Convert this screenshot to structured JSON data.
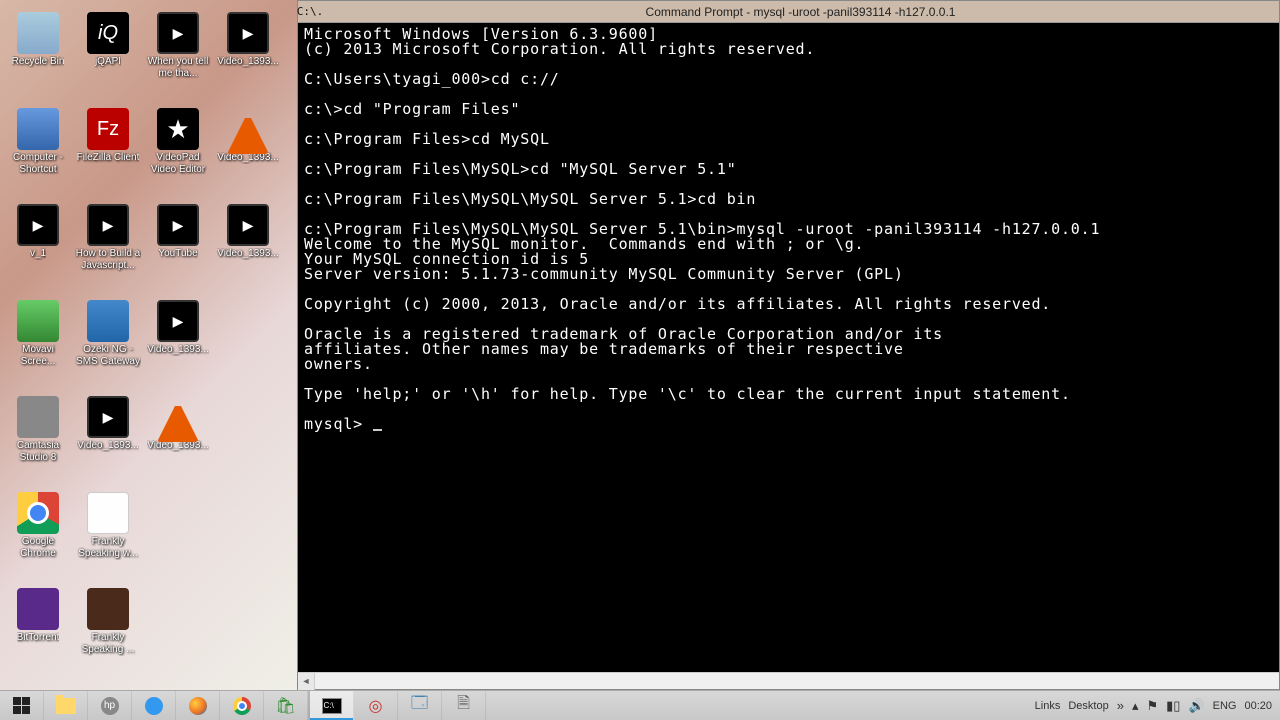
{
  "desktop_icons": [
    {
      "name": "recycle-bin",
      "label": "Recycle Bin",
      "style": "ic-bin"
    },
    {
      "name": "jqapi",
      "label": "jQAPI",
      "style": "ic-jq",
      "glyph": "iQ"
    },
    {
      "name": "when-you-tell",
      "label": "When you tell me tha...",
      "style": "ic-vid"
    },
    {
      "name": "video-1",
      "label": "Video_1393...",
      "style": "ic-vid"
    },
    {
      "name": "computer-shortcut",
      "label": "Computer - Shortcut",
      "style": "ic-monitor"
    },
    {
      "name": "filezilla",
      "label": "FileZilla Client",
      "style": "ic-fz",
      "glyph": "Fz"
    },
    {
      "name": "videopad",
      "label": "VideoPad Video Editor",
      "style": "ic-star"
    },
    {
      "name": "video-2",
      "label": "Video_1393...",
      "style": "ic-vlc"
    },
    {
      "name": "v1",
      "label": "v_1",
      "style": "ic-vid"
    },
    {
      "name": "howto-js",
      "label": "How to Build a Javascript...",
      "style": "ic-vid"
    },
    {
      "name": "youtube",
      "label": "YouTube",
      "style": "ic-vid"
    },
    {
      "name": "video-3",
      "label": "Video_1393...",
      "style": "ic-vid"
    },
    {
      "name": "movavi",
      "label": "Movavi Scree...",
      "style": "ic-movavi"
    },
    {
      "name": "ozeki",
      "label": "Ozeki NG - SMS Gateway",
      "style": "ic-ozeki"
    },
    {
      "name": "video-4",
      "label": "Video_1393...",
      "style": "ic-vid"
    },
    {
      "name": "blank-1",
      "label": "",
      "style": ""
    },
    {
      "name": "camtasia",
      "label": "Camtasia Studio 8",
      "style": "ic-camtasia"
    },
    {
      "name": "video-5",
      "label": "Video_1393...",
      "style": "ic-vid"
    },
    {
      "name": "video-6",
      "label": "Video_1393...",
      "style": "ic-vlc"
    },
    {
      "name": "blank-2",
      "label": "",
      "style": ""
    },
    {
      "name": "chrome",
      "label": "Google Chrome",
      "style": "ic-chrome"
    },
    {
      "name": "frankly-1",
      "label": "Frankly Speaking w...",
      "style": "ic-doc"
    },
    {
      "name": "blank-3",
      "label": "",
      "style": ""
    },
    {
      "name": "blank-4",
      "label": "",
      "style": ""
    },
    {
      "name": "bittorrent",
      "label": "BitTorrent",
      "style": "ic-bt"
    },
    {
      "name": "frankly-2",
      "label": "Frankly Speaking ...",
      "style": "ic-frankly"
    }
  ],
  "cmd": {
    "titlebar_icon": "C:\\.",
    "title": "Command Prompt - mysql  -uroot -panil393114 -h127.0.0.1",
    "lines": [
      "Microsoft Windows [Version 6.3.9600]",
      "(c) 2013 Microsoft Corporation. All rights reserved.",
      "",
      "C:\\Users\\tyagi_000>cd c://",
      "",
      "c:\\>cd \"Program Files\"",
      "",
      "c:\\Program Files>cd MySQL",
      "",
      "c:\\Program Files\\MySQL>cd \"MySQL Server 5.1\"",
      "",
      "c:\\Program Files\\MySQL\\MySQL Server 5.1>cd bin",
      "",
      "c:\\Program Files\\MySQL\\MySQL Server 5.1\\bin>mysql -uroot -panil393114 -h127.0.0.1",
      "Welcome to the MySQL monitor.  Commands end with ; or \\g.",
      "Your MySQL connection id is 5",
      "Server version: 5.1.73-community MySQL Community Server (GPL)",
      "",
      "Copyright (c) 2000, 2013, Oracle and/or its affiliates. All rights reserved.",
      "",
      "Oracle is a registered trademark of Oracle Corporation and/or its",
      "affiliates. Other names may be trademarks of their respective",
      "owners.",
      "",
      "Type 'help;' or '\\h' for help. Type '\\c' to clear the current input statement.",
      "",
      "mysql> "
    ]
  },
  "taskbar": {
    "tray": {
      "links_label": "Links",
      "desktop_label": "Desktop",
      "lang": "ENG",
      "time": "00:20"
    }
  }
}
